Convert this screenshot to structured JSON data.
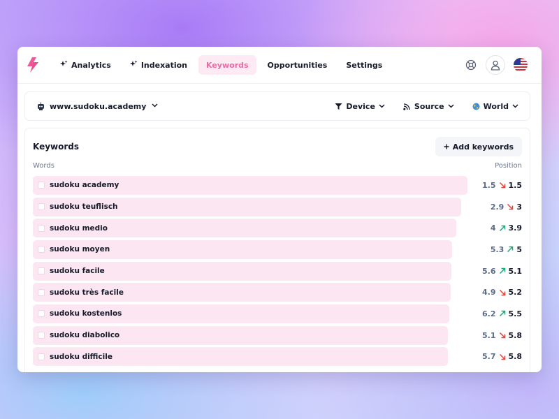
{
  "nav": {
    "tabs": [
      {
        "label": "Analytics",
        "spark": true,
        "active": false
      },
      {
        "label": "Indexation",
        "spark": true,
        "active": false
      },
      {
        "label": "Keywords",
        "spark": false,
        "active": true
      },
      {
        "label": "Opportunities",
        "spark": false,
        "active": false
      },
      {
        "label": "Settings",
        "spark": false,
        "active": false
      }
    ],
    "icons": [
      "logo-bolt-icon",
      "help-buoy-icon",
      "user-icon",
      "us-flag-icon"
    ]
  },
  "filterbar": {
    "site": "www.sudoku.academy",
    "filters": [
      "Device",
      "Source",
      "World"
    ]
  },
  "panel": {
    "title": "Keywords",
    "add_label": "Add keywords",
    "col_words": "Words",
    "col_position": "Position"
  },
  "rows": [
    {
      "keyword": "sudoku academy",
      "prev": "1.5",
      "trend": "down",
      "current": "1.5",
      "bar": 1.0
    },
    {
      "keyword": "sudoku teuflisch",
      "prev": "2.9",
      "trend": "down",
      "current": "3",
      "bar": 0.985
    },
    {
      "keyword": "sudoku medio",
      "prev": "4",
      "trend": "up",
      "current": "3.9",
      "bar": 0.975
    },
    {
      "keyword": "sudoku moyen",
      "prev": "5.3",
      "trend": "up",
      "current": "5",
      "bar": 0.965
    },
    {
      "keyword": "sudoku facile",
      "prev": "5.6",
      "trend": "up",
      "current": "5.1",
      "bar": 0.963
    },
    {
      "keyword": "sudoku très facile",
      "prev": "4.9",
      "trend": "down",
      "current": "5.2",
      "bar": 0.962
    },
    {
      "keyword": "sudoku kostenlos",
      "prev": "6.2",
      "trend": "up",
      "current": "5.5",
      "bar": 0.958
    },
    {
      "keyword": "sudoku diabolico",
      "prev": "5.1",
      "trend": "down",
      "current": "5.8",
      "bar": 0.955
    },
    {
      "keyword": "sudoku difficile",
      "prev": "5.7",
      "trend": "down",
      "current": "5.8",
      "bar": 0.955
    }
  ],
  "colors": {
    "accent": "#ec6aa6",
    "bar": "#fbe6f1",
    "up": "#19a87a",
    "down": "#e0433a"
  }
}
